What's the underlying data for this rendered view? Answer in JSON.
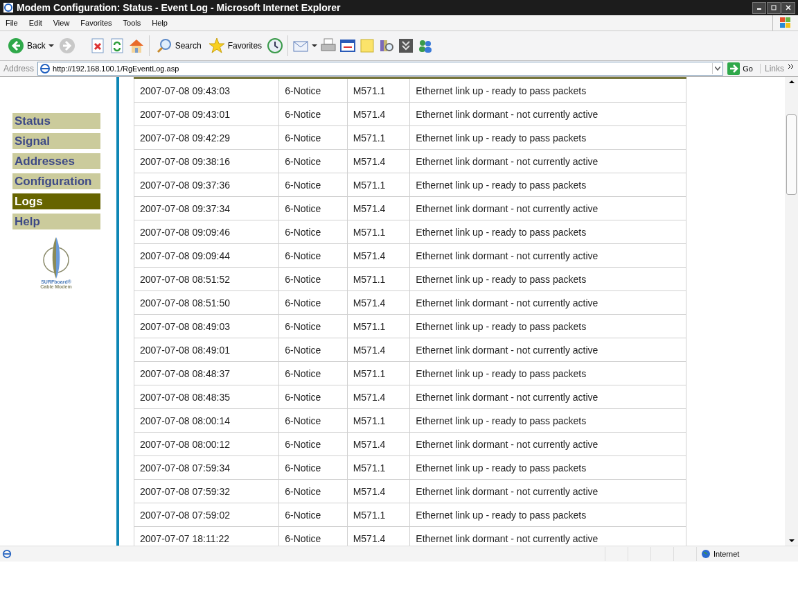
{
  "window": {
    "title": "Modem Configuration: Status - Event Log - Microsoft Internet Explorer"
  },
  "menu": [
    "File",
    "Edit",
    "View",
    "Favorites",
    "Tools",
    "Help"
  ],
  "toolbar": {
    "back": "Back",
    "search": "Search",
    "favorites": "Favorites"
  },
  "address_bar": {
    "label": "Address",
    "url": "http://192.168.100.1/RgEventLog.asp",
    "go": "Go",
    "links": "Links"
  },
  "sidebar": {
    "items": [
      {
        "label": "Status",
        "selected": false
      },
      {
        "label": "Signal",
        "selected": false
      },
      {
        "label": "Addresses",
        "selected": false
      },
      {
        "label": "Configuration",
        "selected": false
      },
      {
        "label": "Logs",
        "selected": true
      },
      {
        "label": "Help",
        "selected": false
      }
    ],
    "logo": {
      "brand": "SURFboard®",
      "subtitle": "Cable Modem"
    }
  },
  "log": {
    "rows": [
      [
        "2007-07-08 09:43:03",
        "6-Notice",
        "M571.1",
        "Ethernet link up - ready to pass packets"
      ],
      [
        "2007-07-08 09:43:01",
        "6-Notice",
        "M571.4",
        "Ethernet link dormant - not currently active"
      ],
      [
        "2007-07-08 09:42:29",
        "6-Notice",
        "M571.1",
        "Ethernet link up - ready to pass packets"
      ],
      [
        "2007-07-08 09:38:16",
        "6-Notice",
        "M571.4",
        "Ethernet link dormant - not currently active"
      ],
      [
        "2007-07-08 09:37:36",
        "6-Notice",
        "M571.1",
        "Ethernet link up - ready to pass packets"
      ],
      [
        "2007-07-08 09:37:34",
        "6-Notice",
        "M571.4",
        "Ethernet link dormant - not currently active"
      ],
      [
        "2007-07-08 09:09:46",
        "6-Notice",
        "M571.1",
        "Ethernet link up - ready to pass packets"
      ],
      [
        "2007-07-08 09:09:44",
        "6-Notice",
        "M571.4",
        "Ethernet link dormant - not currently active"
      ],
      [
        "2007-07-08 08:51:52",
        "6-Notice",
        "M571.1",
        "Ethernet link up - ready to pass packets"
      ],
      [
        "2007-07-08 08:51:50",
        "6-Notice",
        "M571.4",
        "Ethernet link dormant - not currently active"
      ],
      [
        "2007-07-08 08:49:03",
        "6-Notice",
        "M571.1",
        "Ethernet link up - ready to pass packets"
      ],
      [
        "2007-07-08 08:49:01",
        "6-Notice",
        "M571.4",
        "Ethernet link dormant - not currently active"
      ],
      [
        "2007-07-08 08:48:37",
        "6-Notice",
        "M571.1",
        "Ethernet link up - ready to pass packets"
      ],
      [
        "2007-07-08 08:48:35",
        "6-Notice",
        "M571.4",
        "Ethernet link dormant - not currently active"
      ],
      [
        "2007-07-08 08:00:14",
        "6-Notice",
        "M571.1",
        "Ethernet link up - ready to pass packets"
      ],
      [
        "2007-07-08 08:00:12",
        "6-Notice",
        "M571.4",
        "Ethernet link dormant - not currently active"
      ],
      [
        "2007-07-08 07:59:34",
        "6-Notice",
        "M571.1",
        "Ethernet link up - ready to pass packets"
      ],
      [
        "2007-07-08 07:59:32",
        "6-Notice",
        "M571.4",
        "Ethernet link dormant - not currently active"
      ],
      [
        "2007-07-08 07:59:02",
        "6-Notice",
        "M571.1",
        "Ethernet link up - ready to pass packets"
      ],
      [
        "2007-07-07 18:11:22",
        "6-Notice",
        "M571.4",
        "Ethernet link dormant - not currently active"
      ]
    ]
  },
  "status_bar": {
    "zone": "Internet"
  }
}
